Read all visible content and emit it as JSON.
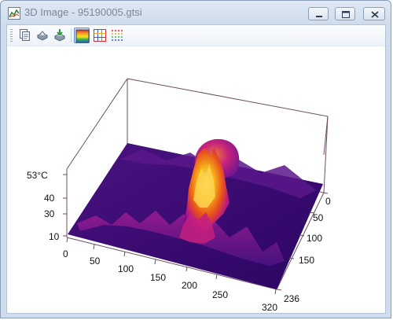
{
  "window": {
    "title": "3D Image - 95190005.gtsi",
    "controls": [
      "minimize",
      "maximize",
      "close"
    ]
  },
  "toolbar": {
    "buttons": [
      {
        "name": "copy-report-icon",
        "active": false
      },
      {
        "name": "print-icon",
        "active": false
      },
      {
        "name": "export-icon",
        "active": false
      },
      {
        "name": "color-palette-surface-icon",
        "active": true
      },
      {
        "name": "grid-mesh-icon",
        "active": false
      },
      {
        "name": "dot-grid-icon",
        "active": false
      }
    ]
  },
  "chart_data": {
    "type": "surface3d",
    "z_unit": "°C",
    "z_ticks": [
      "53°C",
      "40",
      "30",
      "10"
    ],
    "x_ticks": [
      "0",
      "50",
      "100",
      "150",
      "200",
      "250",
      "320"
    ],
    "y_ticks": [
      "0",
      "50",
      "100",
      "150",
      "236"
    ],
    "xlim": [
      0,
      320
    ],
    "ylim": [
      0,
      236
    ],
    "zlim": [
      10,
      53
    ],
    "colormap": "thermal (purple-red-orange-yellow)",
    "colors": {
      "low": "#3a0a6e",
      "mid": "#b3128a",
      "warm": "#e8501c",
      "high": "#f5c21a",
      "max": "#fde68a"
    }
  }
}
